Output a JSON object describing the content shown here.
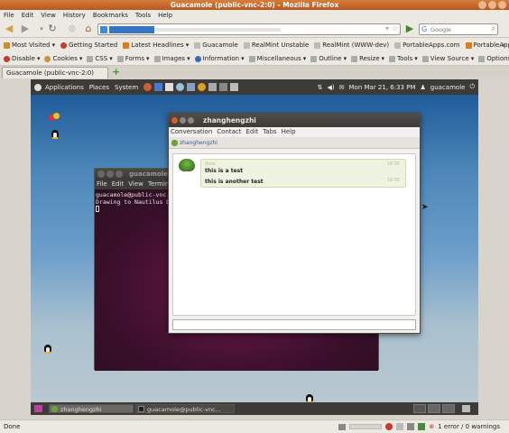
{
  "browser": {
    "title": "Guacamole (public-vnc-2:0) - Mozilla Firefox",
    "menu": [
      "File",
      "Edit",
      "View",
      "History",
      "Bookmarks",
      "Tools",
      "Help"
    ],
    "search_placeholder": "Google",
    "bookmarks": [
      "Most Visited",
      "Getting Started",
      "Latest Headlines",
      "Guacamole",
      "RealMint Unstable",
      "RealMint (WWW-dev)",
      "PortableApps.com",
      "PortableApps.co..."
    ],
    "devtools": [
      "Disable",
      "Cookies",
      "CSS",
      "Forms",
      "Images",
      "Information",
      "Miscellaneous",
      "Outline",
      "Resize",
      "Tools",
      "View Source",
      "Options"
    ],
    "tab_label": "Guacamole (public-vnc-2:0)",
    "status_left": "Done",
    "status_right": "1 error / 0 warnings",
    "accent": "#c0602a"
  },
  "remote": {
    "top_panel": {
      "menus": [
        "Applications",
        "Places",
        "System"
      ],
      "clock": "Mon Mar 21, 6:33 PM",
      "user": "guacamole"
    },
    "terminal": {
      "title": "guacamole@public-vnc-",
      "menu": [
        "File",
        "Edit",
        "View",
        "Terminal"
      ],
      "lines": [
        "guacamole@public-vnc-",
        "Drawing to Nautilus De"
      ]
    },
    "chat": {
      "title": "zhanghengzhi",
      "menu": [
        "Conversation",
        "Contact",
        "Edit",
        "Tabs",
        "Help"
      ],
      "tab": "zhanghengzhi",
      "sender": "Rose",
      "messages": [
        {
          "text": "this is a test",
          "time": "18:05"
        },
        {
          "text": "this is another test",
          "time": "18:05"
        }
      ]
    },
    "taskbar": [
      "zhanghengzhi",
      "guacamole@public-vnc..."
    ]
  }
}
